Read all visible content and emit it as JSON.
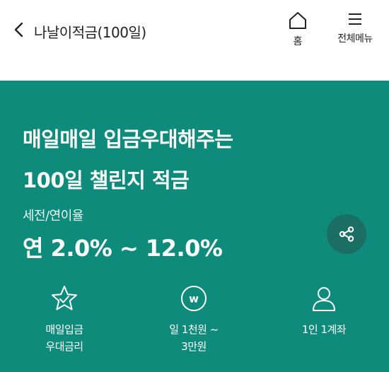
{
  "header": {
    "back_icon": "chevron-left-icon",
    "title": "나날이적금(100일)",
    "home_label": "홈",
    "home_icon": "home-icon",
    "menu_label": "전체메뉴",
    "menu_icon": "hamburger-icon"
  },
  "hero": {
    "background_color": "#0f8b7c",
    "headline_line1": "매일매일 입금우대해주는",
    "headline_line2": "100일 챌린지 적금",
    "rate_label": "세전/연이율",
    "rate_value": "연 2.0% ~ 12.0%",
    "share_icon": "share-icon"
  },
  "features": [
    {
      "icon": "star-check-icon",
      "line1": "매일입금",
      "line2": "우대금리"
    },
    {
      "icon": "won-coin-icon",
      "line1": "일 1천원 ~",
      "line2": "3만원"
    },
    {
      "icon": "person-icon",
      "line1": "1인 1계좌",
      "line2": ""
    }
  ]
}
